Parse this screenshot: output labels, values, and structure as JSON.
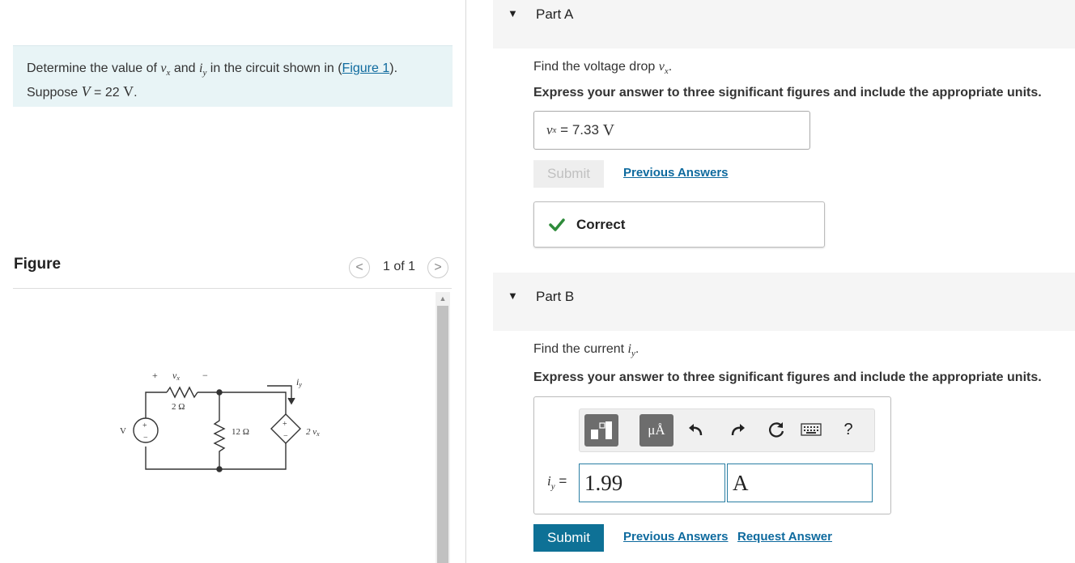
{
  "problem": {
    "text_a": "Determine the value of ",
    "var_vx": "v",
    "var_vx_sub": "x",
    "text_b": " and ",
    "var_iy": "i",
    "var_iy_sub": "y",
    "text_c": " in the circuit shown in (",
    "figure_link": "Figure 1",
    "text_d": ").",
    "suppose": "Suppose ",
    "var_V": "V",
    "value": " = 22 ",
    "unit": "V",
    "period": "."
  },
  "figure": {
    "title": "Figure",
    "counter": "1 of 1",
    "prev_glyph": "<",
    "next_glyph": ">",
    "labels": {
      "plus": "+",
      "minus": "−",
      "vx": "v",
      "vx_sub": "x",
      "r1": "2 Ω",
      "r2": "12 Ω",
      "dep": "2 v",
      "dep_sub": "x",
      "V": "V",
      "iy": "i",
      "iy_sub": "y"
    }
  },
  "partA": {
    "title": "Part A",
    "prompt_text": "Find the voltage drop ",
    "prompt_var": "v",
    "prompt_sub": "x",
    "prompt_end": ".",
    "instruction": "Express your answer to three significant figures and include the appropriate units.",
    "answer_var": "v",
    "answer_sub": "x",
    "answer_eq": " = ",
    "answer_value": "7.33",
    "answer_unit": "V",
    "submit_label": "Submit",
    "previous_answers": "Previous Answers",
    "correct_label": "Correct"
  },
  "partB": {
    "title": "Part B",
    "prompt_text": "Find the current ",
    "prompt_var": "i",
    "prompt_sub": "y",
    "prompt_end": ".",
    "instruction": "Express your answer to three significant figures and include the appropriate units.",
    "answer_var": "i",
    "answer_sub": "y",
    "answer_eq": " = ",
    "value_field": "1.99",
    "unit_field": "A",
    "units_button_label": "μÅ",
    "help_label": "?",
    "submit_label": "Submit",
    "previous_answers": "Previous Answers",
    "request_answer": "Request Answer"
  },
  "colors": {
    "accent": "#0e7196",
    "link": "#0e6a9e",
    "problem_bg": "#e8f4f6",
    "correct_check": "#2e8b3a"
  },
  "icons": [
    "caret-down-icon",
    "check-icon",
    "templates-icon",
    "units-icon",
    "undo-icon",
    "redo-icon",
    "reset-icon",
    "keyboard-icon",
    "help-icon"
  ]
}
